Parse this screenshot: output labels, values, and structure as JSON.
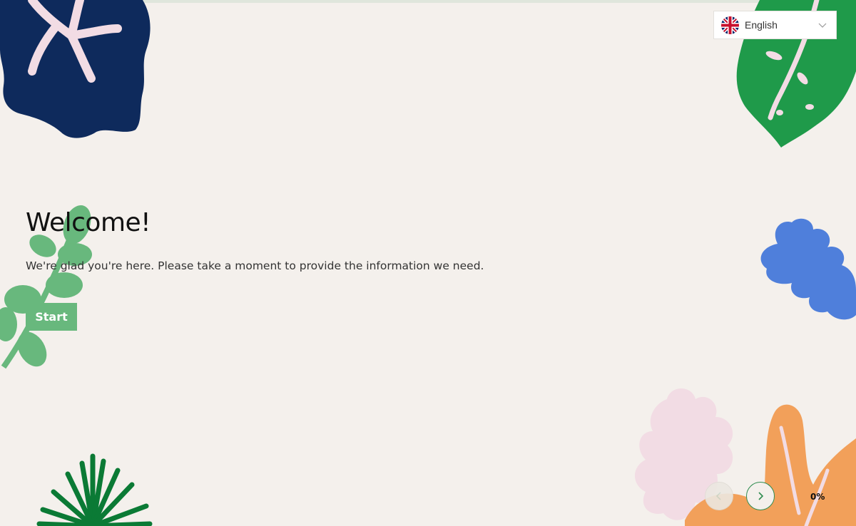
{
  "language": {
    "selected": "English",
    "flag": "uk-flag-icon"
  },
  "welcome": {
    "title": "Welcome!",
    "text": "We're glad you're here. Please take a moment to provide the information we need.",
    "start_label": "Start"
  },
  "navigation": {
    "prev_icon": "chevron-left-icon",
    "next_icon": "chevron-right-icon",
    "progress": "0%",
    "progress_value": 0
  },
  "colors": {
    "background": "#f4f0ec",
    "accent": "#68b87d",
    "navy_leaf": "#0e2a5c",
    "green_leaf": "#1f9a4a",
    "blue_leaf": "#4f7fdb",
    "orange_leaf": "#f2a05a",
    "pink_leaf": "#f2dce4"
  }
}
